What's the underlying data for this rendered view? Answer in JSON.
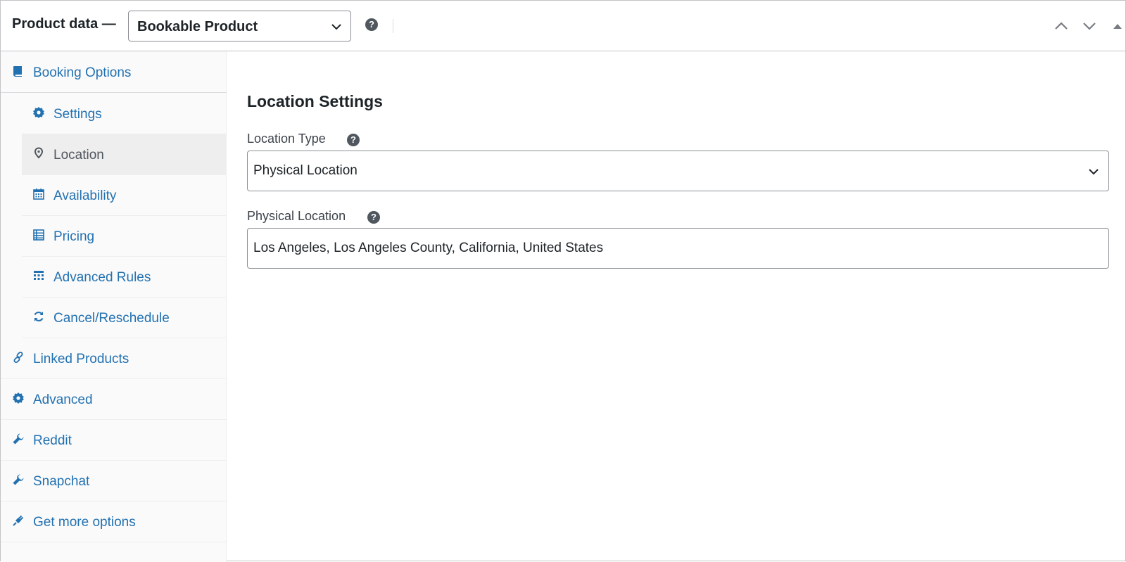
{
  "header": {
    "title": "Product data —",
    "product_type": "Bookable Product",
    "help_glyph": "?",
    "controls": [
      "move-up-icon",
      "move-down-icon",
      "toggle-panel-icon"
    ]
  },
  "sidebar": {
    "items": [
      {
        "label": "Booking Options",
        "icon": "book-icon",
        "level": 0,
        "active": false
      },
      {
        "label": "Settings",
        "icon": "gear-icon",
        "level": 1,
        "active": false
      },
      {
        "label": "Location",
        "icon": "location-pin-icon",
        "level": 1,
        "active": true
      },
      {
        "label": "Availability",
        "icon": "calendar-icon",
        "level": 1,
        "active": false
      },
      {
        "label": "Pricing",
        "icon": "list-icon",
        "level": 1,
        "active": false
      },
      {
        "label": "Advanced Rules",
        "icon": "table-icon",
        "level": 1,
        "active": false
      },
      {
        "label": "Cancel/Reschedule",
        "icon": "refresh-icon",
        "level": 1,
        "active": false
      },
      {
        "label": "Linked Products",
        "icon": "link-icon",
        "level": 0,
        "active": false
      },
      {
        "label": "Advanced",
        "icon": "gear-icon",
        "level": 0,
        "active": false
      },
      {
        "label": "Reddit",
        "icon": "wrench-icon",
        "level": 0,
        "active": false
      },
      {
        "label": "Snapchat",
        "icon": "wrench-icon",
        "level": 0,
        "active": false
      },
      {
        "label": "Get more options",
        "icon": "plug-icon",
        "level": 0,
        "active": false
      }
    ]
  },
  "main": {
    "section_title": "Location Settings",
    "location_type": {
      "label": "Location Type",
      "value": "Physical Location"
    },
    "physical_location": {
      "label": "Physical Location",
      "value": "Los Angeles, Los Angeles County, California, United States"
    }
  },
  "colors": {
    "link": "#2271b1",
    "active_text": "#50575e",
    "active_bg": "#eeeeee",
    "sidebar_bg": "#fafafa",
    "border": "#c3c4c7"
  }
}
